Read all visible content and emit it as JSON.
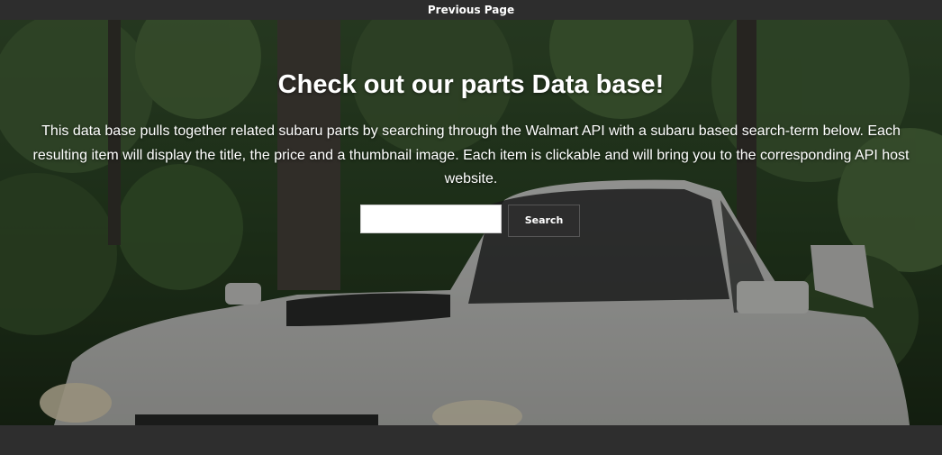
{
  "topbar": {
    "previous_page_label": "Previous Page"
  },
  "hero": {
    "title": "Check out our parts Data base!",
    "description": "This data base pulls together related subaru parts by searching through the Walmart API with a subaru based search-term below. Each resulting item will display the title, the price and a thumbnail image. Each item is clickable and will bring you to the corresponding API host website.",
    "background_image": "white subaru sedan in forest"
  },
  "search": {
    "input_value": "",
    "button_label": "Search"
  },
  "colors": {
    "bar_background": "#2d2d2d",
    "text": "#ffffff"
  }
}
